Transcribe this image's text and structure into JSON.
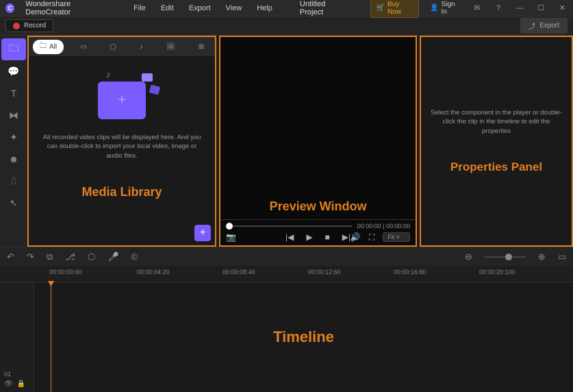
{
  "app": {
    "name": "Wondershare DemoCreator",
    "project": "Untitled Project"
  },
  "menu": {
    "file": "File",
    "edit": "Edit",
    "export": "Export",
    "view": "View",
    "help": "Help"
  },
  "header": {
    "buy_now": "Buy Now",
    "sign_in": "Sign In"
  },
  "toolbar": {
    "record": "Record",
    "export": "Export"
  },
  "media": {
    "all_tab": "All",
    "hint": "All recorded video clips will be displayed here. And you can double-click to import your local video, image or audio files.",
    "label": "Media Library"
  },
  "preview": {
    "label": "Preview Window",
    "time_current": "00:00:00",
    "time_sep": " | ",
    "time_total": "00:00:00",
    "fit": "Fit"
  },
  "properties": {
    "hint": "Select the component in the player or double-click the clip in the timeline to edit the properties",
    "label": "Properties Panel"
  },
  "timeline": {
    "label": "Timeline",
    "track": "01",
    "ticks": [
      "00:00:00:00",
      "00:00:04:20",
      "00:00:08:40",
      "00:00:12:60",
      "00:00:16:80",
      "00:00:20:100"
    ]
  }
}
